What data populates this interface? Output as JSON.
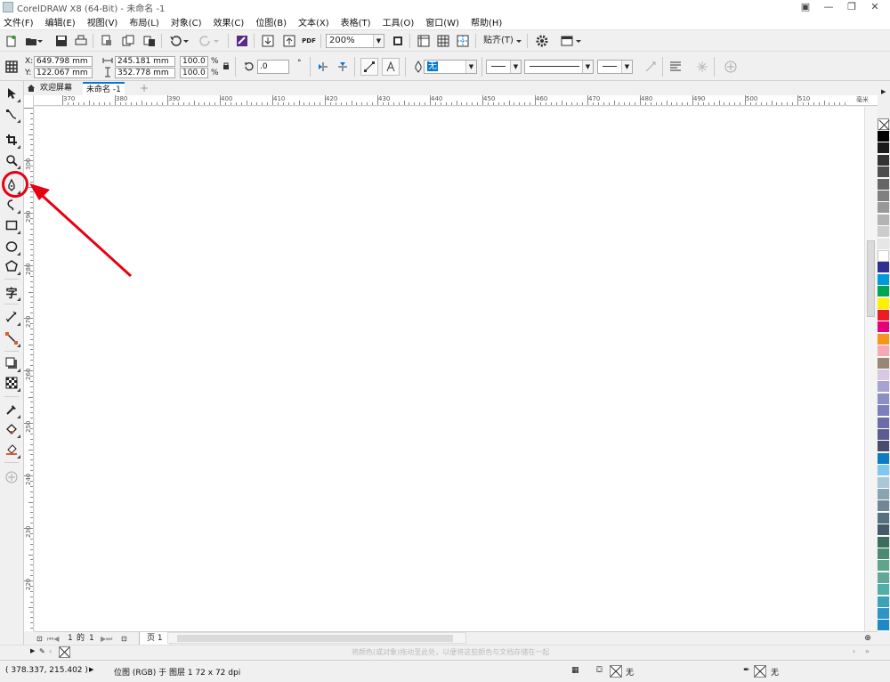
{
  "app": {
    "title": "CorelDRAW X8 (64-Bit) - 未命名 -1"
  },
  "menu": [
    "文件(F)",
    "编辑(E)",
    "视图(V)",
    "布局(L)",
    "对象(C)",
    "效果(C)",
    "位图(B)",
    "文本(X)",
    "表格(T)",
    "工具(O)",
    "窗口(W)",
    "帮助(H)"
  ],
  "standard_toolbar": {
    "zoom": "200%",
    "snap_label": "贴齐(T)",
    "pdf_label": "PDF"
  },
  "property_bar": {
    "x": "649.798 mm",
    "y": "122.067 mm",
    "x_label": "X:",
    "y_label": "Y:",
    "width": "245.181 mm",
    "height": "352.778 mm",
    "scale_w": "100.0",
    "scale_h": "100.0",
    "pct": "%",
    "rotation": ".0",
    "fill": "无"
  },
  "doc_tabs": {
    "welcome": "欢迎屏幕",
    "doc": "未命名 -1"
  },
  "ruler": {
    "top_labels": [
      "370",
      "380",
      "390",
      "400",
      "410",
      "420",
      "430",
      "440",
      "450",
      "460",
      "470",
      "480",
      "490",
      "500",
      "510"
    ],
    "unit": "毫米",
    "left_labels": [
      "300",
      "290",
      "280",
      "270",
      "260",
      "250",
      "240",
      "230",
      "220",
      "210"
    ]
  },
  "page_nav": {
    "current": "1",
    "of": "的",
    "total": "1",
    "page_tab": "页 1"
  },
  "doc_palette_hint": "将颜色(或对象)拖动至此处，以便将这些颜色与文档存储在一起",
  "status": {
    "coords": "( 378.337, 215.402 )",
    "info": "位图 (RGB) 于 图层 1 72 x 72 dpi",
    "fill_none": "无",
    "outline_none": "无"
  },
  "palette_colors": [
    "#000000",
    "#1a1a1a",
    "#333333",
    "#4d4d4d",
    "#666666",
    "#808080",
    "#999999",
    "#b3b3b3",
    "#cccccc",
    "#e6e6e6",
    "#ffffff",
    "#2e3192",
    "#0099dd",
    "#00a651",
    "#fff200",
    "#ed1c24",
    "#e6007e",
    "#f7941d",
    "#f6a9b5",
    "#998675",
    "#d7c9e6",
    "#a6a2d4",
    "#8b8fc8",
    "#7b7fbc",
    "#6f6aa8",
    "#5c5d8e",
    "#4a4a6e",
    "#0d7bc4",
    "#7ec8f0",
    "#a8c8d8",
    "#8aa3b3",
    "#6f8797",
    "#55707e",
    "#425b66",
    "#3b6e5e",
    "#4d8a74",
    "#5fa58b",
    "#62a89a",
    "#4fb0a8",
    "#3aa3b5",
    "#2e95c4",
    "#1f88c7"
  ],
  "colors": {
    "annotation": "#e60012",
    "accent": "#0078d7"
  }
}
